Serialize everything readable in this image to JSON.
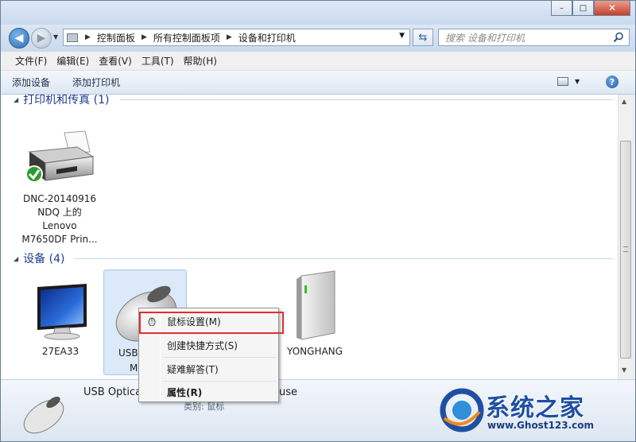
{
  "window": {
    "caption_buttons": {
      "minimize": "–",
      "maximize": "□",
      "close": "✕"
    }
  },
  "address": {
    "crumbs": [
      "控制面板",
      "所有控制面板项",
      "设备和打印机"
    ],
    "search_placeholder": "搜索 设备和打印机"
  },
  "menubar": {
    "items": [
      "文件(F)",
      "编辑(E)",
      "查看(V)",
      "工具(T)",
      "帮助(H)"
    ]
  },
  "commandbar": {
    "add_device": "添加设备",
    "add_printer": "添加打印机",
    "help": "?"
  },
  "groups": {
    "printers": {
      "title": "打印机和传真 (1)"
    },
    "devices": {
      "title": "设备 (4)"
    }
  },
  "printer": {
    "label_lines": [
      "DNC-20140916",
      "NDQ 上的",
      "Lenovo",
      "M7650DF Prin..."
    ]
  },
  "devices": {
    "monitor": "27EA33",
    "mouse_partial": [
      "USB",
      "M"
    ],
    "drive": "YONGHANG"
  },
  "context_menu": {
    "items": [
      {
        "label": "鼠标设置(M)",
        "bold": false
      },
      {
        "label": "创建快捷方式(S)",
        "bold": false
      },
      {
        "label": "疑难解答(T)",
        "bold": false
      },
      {
        "label": "属性(R)",
        "bold": true
      }
    ]
  },
  "details": {
    "name_visible": "USB Optica",
    "name_tail": "ouse",
    "category": "类别: 鼠标"
  },
  "watermark": {
    "title": "系统之家",
    "url": "www.Ghost123.com"
  },
  "colors": {
    "group_header": "#1e3d8f",
    "highlight": "#e0302a",
    "selection": "#dbe9f8"
  }
}
